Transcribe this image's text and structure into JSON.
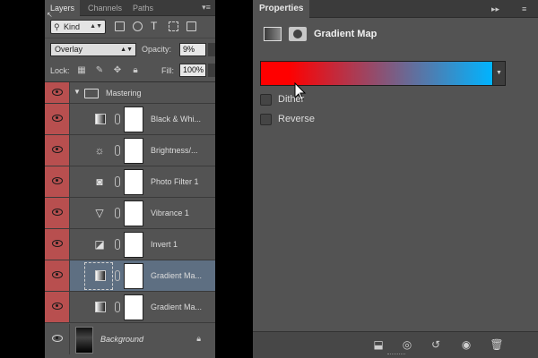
{
  "layers_panel": {
    "tabs": [
      "Layers",
      "Channels",
      "Paths"
    ],
    "menu_glyph": "▾≡",
    "filter": {
      "kind": "Kind"
    },
    "blend_mode": "Overlay",
    "opacity_label": "Opacity:",
    "opacity_value": "9%",
    "lock_label": "Lock:",
    "fill_label": "Fill:",
    "fill_value": "100%",
    "group_name": "Mastering",
    "layers": [
      {
        "name": "Black & Whi...",
        "icon": "black-white-icon",
        "visible": true,
        "selected": false
      },
      {
        "name": "Brightness/...",
        "icon": "brightness-icon",
        "visible": true,
        "selected": false
      },
      {
        "name": "Photo Filter 1",
        "icon": "photo-filter-icon",
        "visible": true,
        "selected": false
      },
      {
        "name": "Vibrance 1",
        "icon": "vibrance-icon",
        "visible": true,
        "selected": false
      },
      {
        "name": "Invert 1",
        "icon": "invert-icon",
        "visible": true,
        "selected": false
      },
      {
        "name": "Gradient Ma...",
        "icon": "gradient-map-icon",
        "visible": true,
        "selected": true
      },
      {
        "name": "Gradient Ma...",
        "icon": "gradient-map-icon",
        "visible": true,
        "selected": false
      }
    ],
    "background_layer": "Background"
  },
  "properties_panel": {
    "tab": "Properties",
    "title": "Gradient Map",
    "gradient": {
      "start_color": "#ff0000",
      "end_color": "#00b4ff"
    },
    "dither_label": "Dither",
    "reverse_label": "Reverse",
    "dither_checked": false,
    "reverse_checked": false
  },
  "colors": {
    "panel_bg": "#535353",
    "visibility_bg": "#b84f4f",
    "selected_row": "#5e6f82"
  }
}
